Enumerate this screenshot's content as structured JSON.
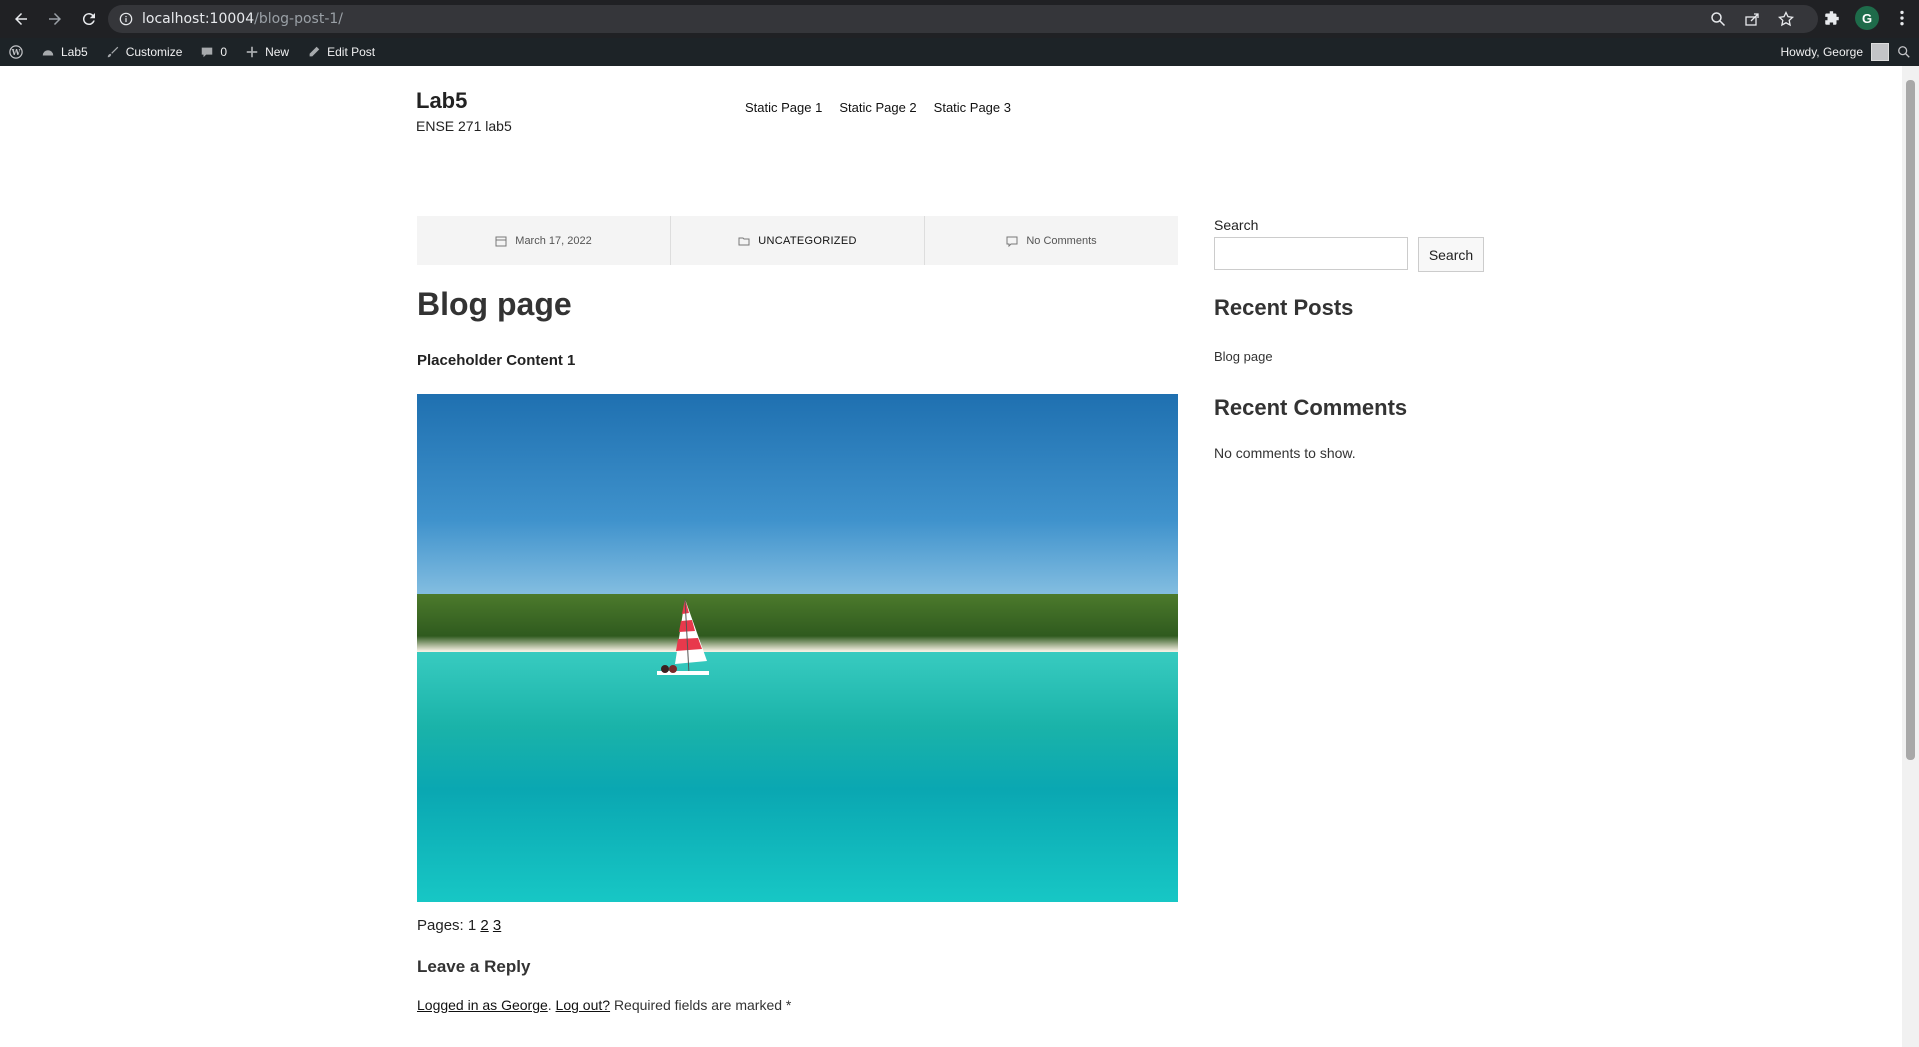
{
  "browser": {
    "url_host": "localhost:10004",
    "url_path": "/blog-post-1/",
    "profile_initial": "G"
  },
  "admin_bar": {
    "site_name": "Lab5",
    "customize": "Customize",
    "comments_count": "0",
    "new": "New",
    "edit_post": "Edit Post",
    "greeting": "Howdy, George"
  },
  "site": {
    "title": "Lab5",
    "description": "ENSE 271 lab5",
    "nav": [
      "Static Page 1",
      "Static Page 2",
      "Static Page 3"
    ]
  },
  "post": {
    "date": "March 17, 2022",
    "category": "UNCATEGORIZED",
    "comments": "No Comments",
    "title": "Blog page",
    "placeholder": "Placeholder Content 1",
    "pages_label": "Pages: 1",
    "pages_links": [
      "2",
      "3"
    ]
  },
  "reply": {
    "title": "Leave a Reply",
    "logged_in_link": "Logged in as George",
    "logout_link": "Log out?",
    "required_text": "Required fields are marked *"
  },
  "sidebar": {
    "search_label": "Search",
    "search_button": "Search",
    "recent_posts_title": "Recent Posts",
    "recent_posts": [
      "Blog page"
    ],
    "recent_comments_title": "Recent Comments",
    "recent_comments_text": "No comments to show."
  }
}
